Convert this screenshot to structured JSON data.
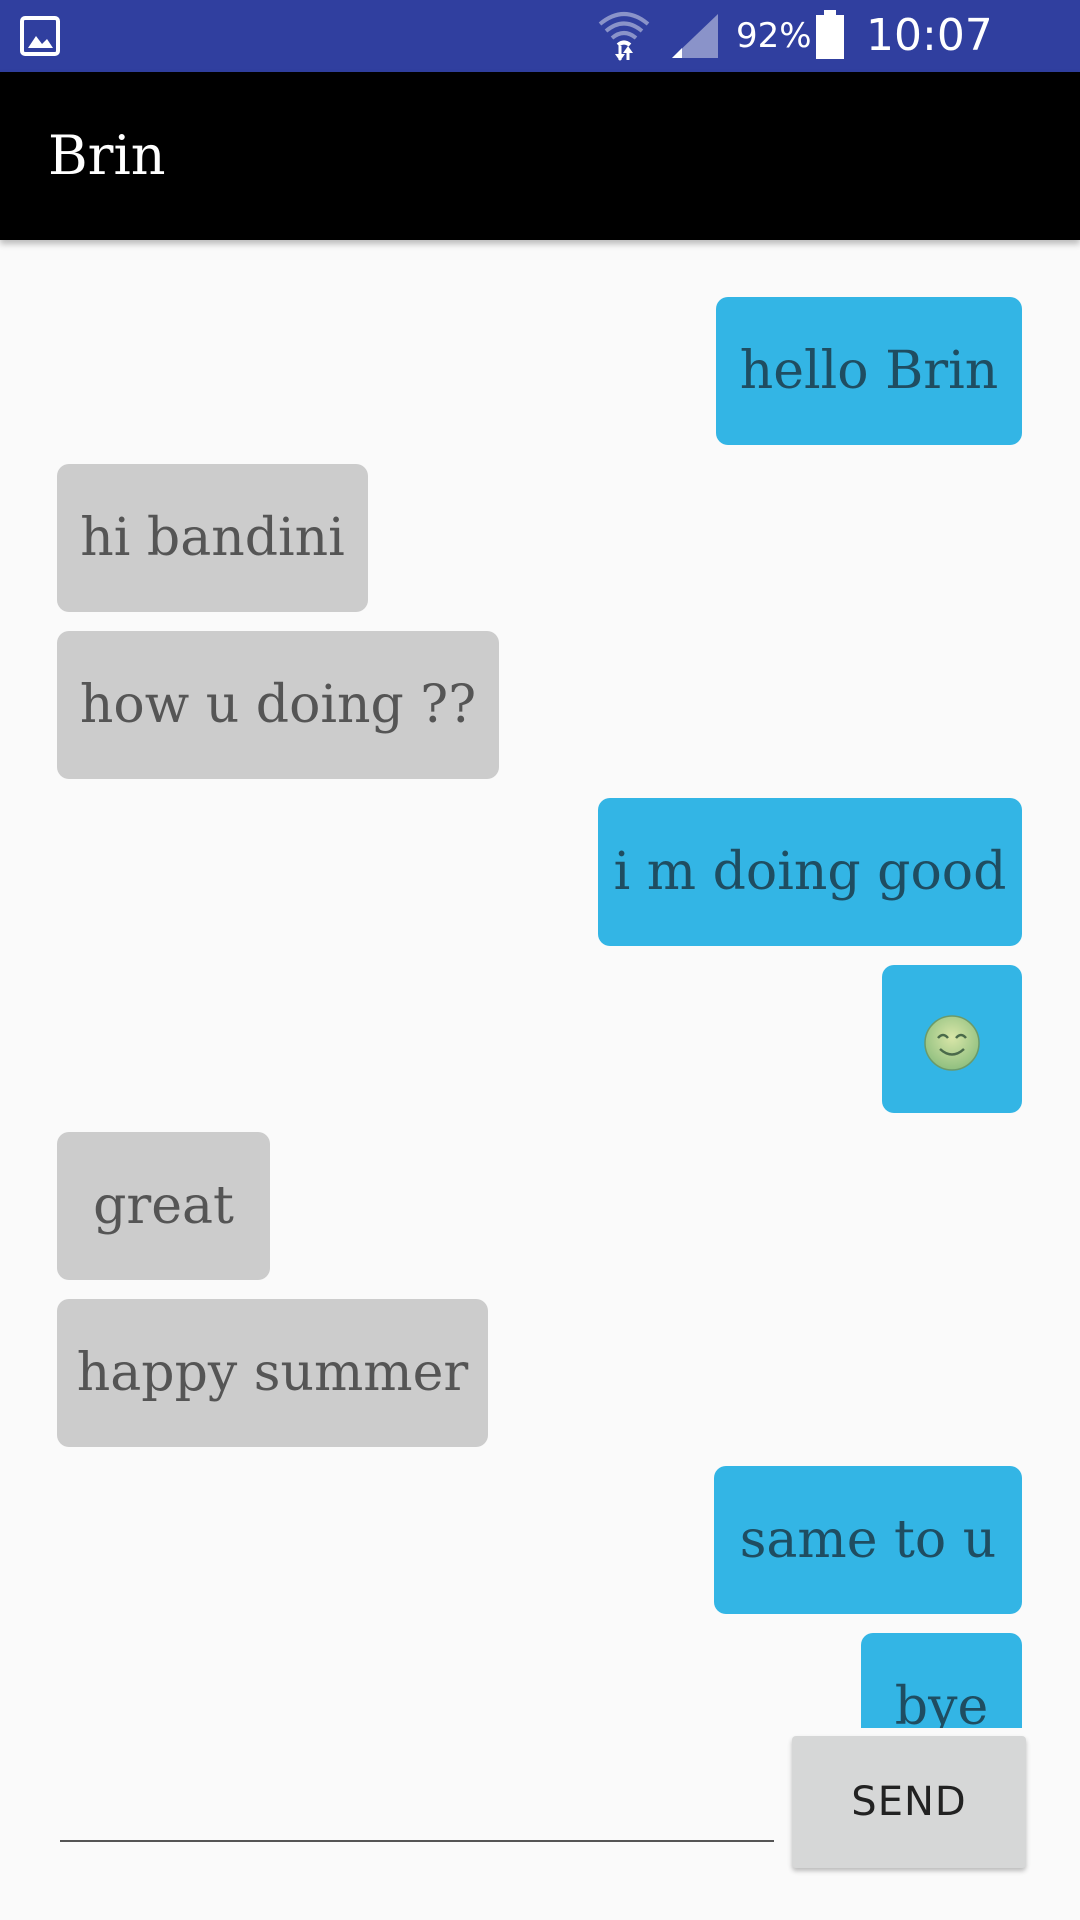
{
  "status_bar": {
    "battery_percent": "92%",
    "time": "10:07 a.m.",
    "icons": [
      "gallery-icon",
      "wifi-icon",
      "signal-icon",
      "battery-icon"
    ],
    "color": "#303f9f"
  },
  "app_bar": {
    "title": "Brin",
    "color": "#000000"
  },
  "messages": [
    {
      "direction": "outgoing",
      "text": "hello Brin"
    },
    {
      "direction": "incoming",
      "text": "hi bandini"
    },
    {
      "direction": "incoming",
      "text": "how u doing ??"
    },
    {
      "direction": "outgoing",
      "text": "i m doing good"
    },
    {
      "direction": "outgoing",
      "text": "",
      "emoji": "smiling-face-emoji"
    },
    {
      "direction": "incoming",
      "text": "great"
    },
    {
      "direction": "incoming",
      "text": "happy summer"
    },
    {
      "direction": "outgoing",
      "text": "same to u"
    },
    {
      "direction": "outgoing",
      "text": "bye"
    }
  ],
  "colors": {
    "outgoing_bubble": "#33b5e5",
    "incoming_bubble": "#cccccc",
    "background": "#fafafa"
  },
  "composer": {
    "input_value": "",
    "send_label": "SEND"
  }
}
